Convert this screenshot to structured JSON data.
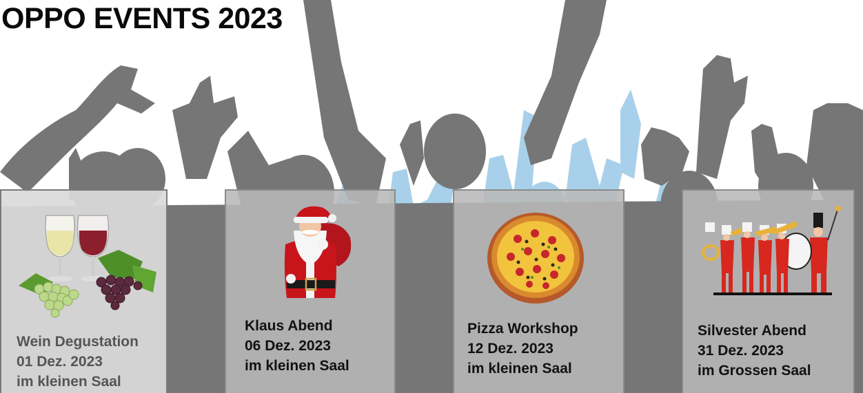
{
  "page": {
    "title": "OPPO EVENTS 2023"
  },
  "colors": {
    "crowd_dark": "#6f6f6f",
    "crowd_light": "#9fcbe8",
    "card_bg": "#b8b8b8",
    "title": "#0a0a0a"
  },
  "events": [
    {
      "name": "Wein Degustation",
      "date": "01 Dez. 2023",
      "location": "im kleinen Saal",
      "icon": "wine-grapes-icon"
    },
    {
      "name": "Klaus Abend",
      "date": "06 Dez. 2023",
      "location": "im kleinen Saal",
      "icon": "santa-claus-icon"
    },
    {
      "name": "Pizza Workshop",
      "date": "12 Dez. 2023",
      "location": "im kleinen Saal",
      "icon": "pizza-icon"
    },
    {
      "name": "Silvester Abend",
      "date": "31 Dez. 2023",
      "location": "im Grossen Saal",
      "icon": "marching-band-icon"
    }
  ]
}
